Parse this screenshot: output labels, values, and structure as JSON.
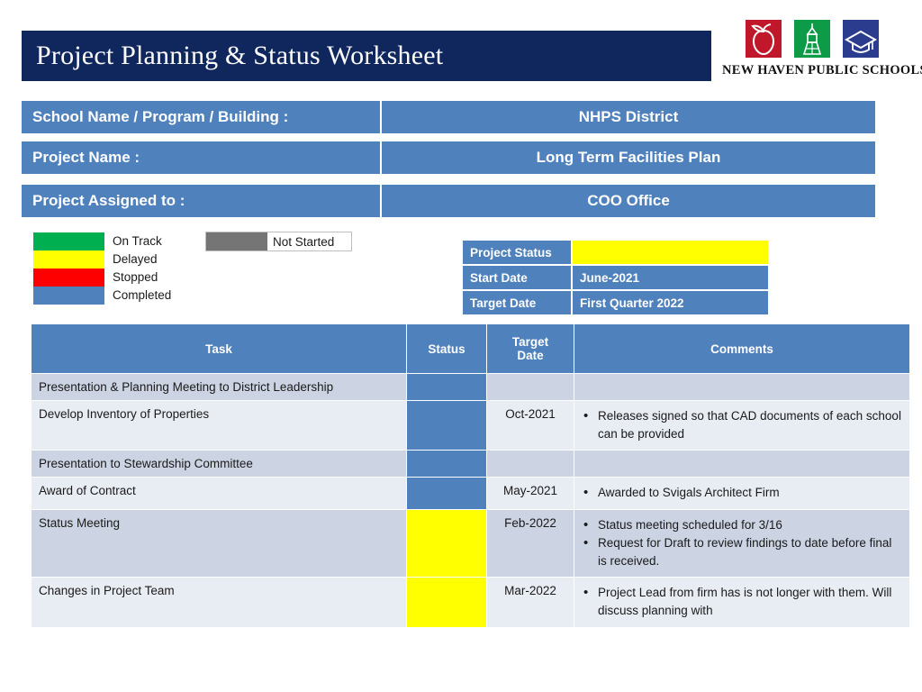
{
  "header": {
    "title": "Project Planning & Status Worksheet",
    "logo": {
      "caption": "NEW HAVEN PUBLIC SCHOOLS",
      "marks": [
        {
          "name": "apple-icon",
          "color": "#C0172A"
        },
        {
          "name": "tower-icon",
          "color": "#0E9B47"
        },
        {
          "name": "graduation-cap-icon",
          "color": "#2B3C8F"
        }
      ]
    },
    "title_bg": "#10275E"
  },
  "info_rows": [
    {
      "label": "School Name / Program / Building :",
      "value": "NHPS District"
    },
    {
      "label": "Project Name :",
      "value": "Long Term Facilities Plan"
    },
    {
      "label": "Project Assigned to :",
      "value": "COO Office"
    }
  ],
  "legend": {
    "items": [
      {
        "label": "On Track",
        "color": "#00B050"
      },
      {
        "label": "Delayed",
        "color": "#FFFF00"
      },
      {
        "label": "Stopped",
        "color": "#FF0000"
      },
      {
        "label": "Completed",
        "color": "#4F81BD"
      }
    ],
    "not_started": {
      "label": "Not Started",
      "color": "#757575"
    }
  },
  "status_block": [
    {
      "key": "Project Status",
      "value": "",
      "fill": "#FFFF00"
    },
    {
      "key": "Start Date",
      "value": "June-2021",
      "fill": "#4F81BD"
    },
    {
      "key": "Target  Date",
      "value": "First Quarter 2022",
      "fill": "#4F81BD"
    }
  ],
  "table": {
    "headers": [
      "Task",
      "Status",
      "Target Date",
      "Comments"
    ],
    "header_target_date_line1": "Target",
    "header_target_date_line2": "Date",
    "rows": [
      {
        "task": "Presentation & Planning Meeting to District Leadership",
        "status": "#4F81BD",
        "status_label": "Completed",
        "date": "",
        "comments": []
      },
      {
        "task": "Develop Inventory of Properties",
        "status": "#4F81BD",
        "status_label": "Completed",
        "date": "Oct-2021",
        "comments": [
          "Releases signed so that CAD documents of each school can be provided"
        ]
      },
      {
        "task": "Presentation to Stewardship Committee",
        "status": "#4F81BD",
        "status_label": "Completed",
        "date": "",
        "comments": []
      },
      {
        "task": "Award of Contract",
        "status": "#4F81BD",
        "status_label": "Completed",
        "date": "May-2021",
        "comments": [
          "Awarded to Svigals Architect Firm"
        ]
      },
      {
        "task": "Status Meeting",
        "status": "#FFFF00",
        "status_label": "Delayed",
        "date": "Feb-2022",
        "comments": [
          "Status meeting scheduled for 3/16",
          "Request for Draft to review findings to date before final is received."
        ]
      },
      {
        "task": "Changes in Project Team",
        "status": "#FFFF00",
        "status_label": "Delayed",
        "date": "Mar-2022",
        "comments": [
          "Project Lead from firm has is not longer with them.  Will discuss planning with"
        ]
      }
    ]
  }
}
